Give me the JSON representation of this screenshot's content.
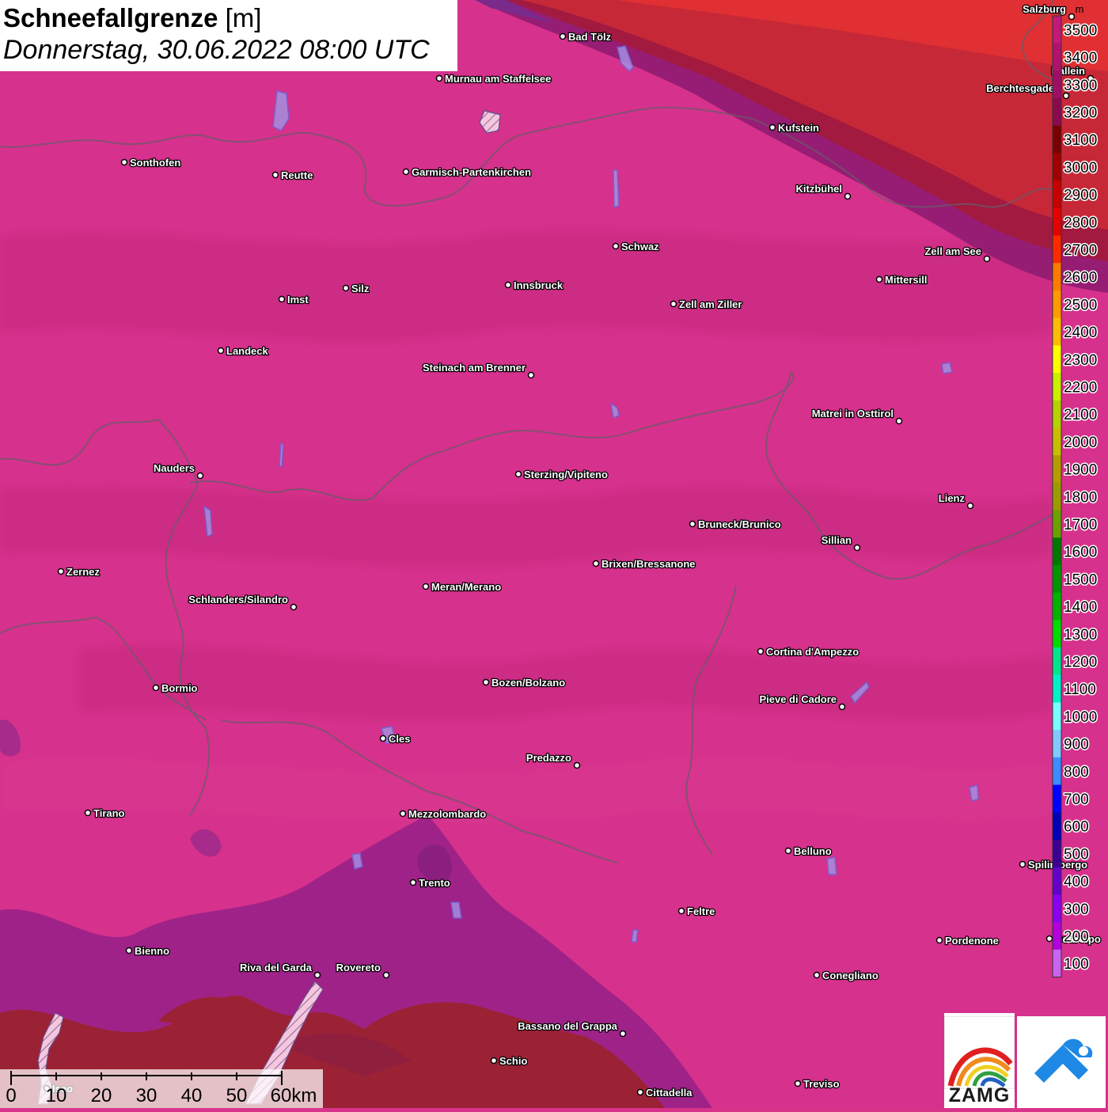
{
  "title": {
    "main": "Schneefallgrenze",
    "unit": "[m]",
    "datetime": "Donnerstag, 30.06.2022 08:00 UTC"
  },
  "legend": {
    "unit_label": "m",
    "levels": [
      {
        "value": "3500",
        "color": "#c2197a"
      },
      {
        "value": "3400",
        "color": "#b0136e"
      },
      {
        "value": "3300",
        "color": "#9e0e66"
      },
      {
        "value": "3200",
        "color": "#8a0a50"
      },
      {
        "value": "3100",
        "color": "#780000"
      },
      {
        "value": "3000",
        "color": "#a00000"
      },
      {
        "value": "2900",
        "color": "#c80000"
      },
      {
        "value": "2800",
        "color": "#e60000"
      },
      {
        "value": "2700",
        "color": "#ff2a00"
      },
      {
        "value": "2600",
        "color": "#ff7a00"
      },
      {
        "value": "2500",
        "color": "#ff9a00"
      },
      {
        "value": "2400",
        "color": "#ffbb00"
      },
      {
        "value": "2300",
        "color": "#ffff00"
      },
      {
        "value": "2200",
        "color": "#c8f000"
      },
      {
        "value": "2100",
        "color": "#b4d200"
      },
      {
        "value": "2000",
        "color": "#c8be00"
      },
      {
        "value": "1900",
        "color": "#b49b00"
      },
      {
        "value": "1800",
        "color": "#9b9b00"
      },
      {
        "value": "1700",
        "color": "#6ea000"
      },
      {
        "value": "1600",
        "color": "#007800"
      },
      {
        "value": "1500",
        "color": "#009600"
      },
      {
        "value": "1400",
        "color": "#00b400"
      },
      {
        "value": "1300",
        "color": "#00dc00"
      },
      {
        "value": "1200",
        "color": "#00e68c"
      },
      {
        "value": "1100",
        "color": "#00f0c8"
      },
      {
        "value": "1000",
        "color": "#78ffff"
      },
      {
        "value": "900",
        "color": "#82c8ff"
      },
      {
        "value": "800",
        "color": "#3c8cff"
      },
      {
        "value": "700",
        "color": "#0000ff"
      },
      {
        "value": "600",
        "color": "#0000b4"
      },
      {
        "value": "500",
        "color": "#3c0090"
      },
      {
        "value": "400",
        "color": "#6400c8"
      },
      {
        "value": "300",
        "color": "#8c00f0"
      },
      {
        "value": "200",
        "color": "#b400dc"
      },
      {
        "value": "100",
        "color": "#c864f0"
      }
    ]
  },
  "cities": [
    {
      "name": "Salzburg",
      "anchor": "end"
    },
    {
      "name": "Hallein",
      "anchor": "end"
    },
    {
      "name": "Berchtesgaden",
      "anchor": "end"
    },
    {
      "name": "Bad Tölz",
      "anchor": "start"
    },
    {
      "name": "Murnau am Staffelsee",
      "anchor": "start"
    },
    {
      "name": "Kufstein",
      "anchor": "start"
    },
    {
      "name": "Sonthofen",
      "anchor": "start"
    },
    {
      "name": "Reutte",
      "anchor": "start"
    },
    {
      "name": "Garmisch-Partenkirchen",
      "anchor": "start"
    },
    {
      "name": "Kitzbühel",
      "anchor": "end"
    },
    {
      "name": "Schwaz",
      "anchor": "start"
    },
    {
      "name": "Zell am See",
      "anchor": "end"
    },
    {
      "name": "Mittersill",
      "anchor": "start"
    },
    {
      "name": "Innsbruck",
      "anchor": "start"
    },
    {
      "name": "Silz",
      "anchor": "start"
    },
    {
      "name": "Imst",
      "anchor": "start"
    },
    {
      "name": "Zell am Ziller",
      "anchor": "start"
    },
    {
      "name": "Landeck",
      "anchor": "start"
    },
    {
      "name": "Steinach am Brenner",
      "anchor": "end"
    },
    {
      "name": "Matrei in Osttirol",
      "anchor": "end"
    },
    {
      "name": "Nauders",
      "anchor": "end"
    },
    {
      "name": "Sterzing/Vipiteno",
      "anchor": "start"
    },
    {
      "name": "Lienz",
      "anchor": "end"
    },
    {
      "name": "Bruneck/Brunico",
      "anchor": "start"
    },
    {
      "name": "Sillian",
      "anchor": "end"
    },
    {
      "name": "Zernez",
      "anchor": "start"
    },
    {
      "name": "Brixen/Bressanone",
      "anchor": "start"
    },
    {
      "name": "Meran/Merano",
      "anchor": "start"
    },
    {
      "name": "Schlanders/Silandro",
      "anchor": "end"
    },
    {
      "name": "Cortina d'Ampezzo",
      "anchor": "start"
    },
    {
      "name": "Bormio",
      "anchor": "start"
    },
    {
      "name": "Bozen/Bolzano",
      "anchor": "start"
    },
    {
      "name": "Pieve di Cadore",
      "anchor": "end"
    },
    {
      "name": "Cles",
      "anchor": "start"
    },
    {
      "name": "Predazzo",
      "anchor": "end"
    },
    {
      "name": "Tirano",
      "anchor": "start"
    },
    {
      "name": "Mezzolombardo",
      "anchor": "start"
    },
    {
      "name": "Belluno",
      "anchor": "start"
    },
    {
      "name": "Spilimbergo",
      "anchor": "start"
    },
    {
      "name": "Trento",
      "anchor": "start"
    },
    {
      "name": "Feltre",
      "anchor": "start"
    },
    {
      "name": "Pordenone",
      "anchor": "start"
    },
    {
      "name": "Codroipo",
      "anchor": "start"
    },
    {
      "name": "Bienno",
      "anchor": "start"
    },
    {
      "name": "Riva del Garda",
      "anchor": "end"
    },
    {
      "name": "Rovereto",
      "anchor": "end"
    },
    {
      "name": "Conegliano",
      "anchor": "start"
    },
    {
      "name": "Bassano del Grappa",
      "anchor": "end"
    },
    {
      "name": "Schio",
      "anchor": "start"
    },
    {
      "name": "Treviso",
      "anchor": "start"
    },
    {
      "name": "Iseo",
      "anchor": "start"
    },
    {
      "name": "Cittadella",
      "anchor": "start"
    }
  ],
  "scale_bar": {
    "labels": [
      "0",
      "10",
      "20",
      "30",
      "40",
      "50",
      "60km"
    ]
  },
  "logos": {
    "zamg": "ZAMG"
  }
}
